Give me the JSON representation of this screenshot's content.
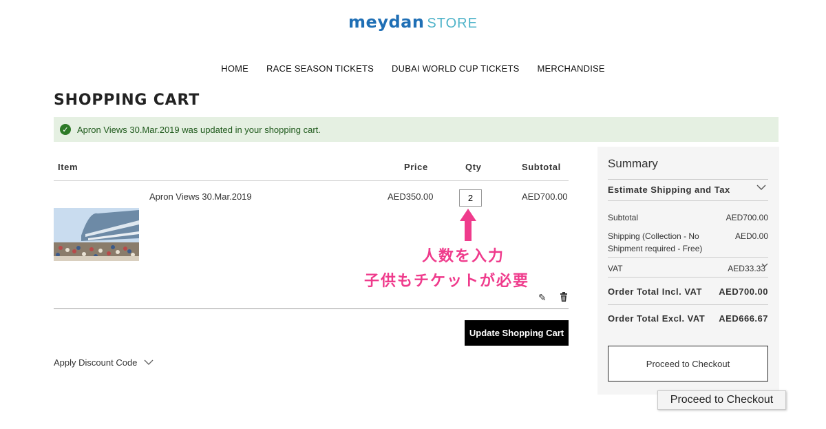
{
  "header": {
    "logo_brand": "meydan",
    "logo_store": "STORE"
  },
  "nav": {
    "items": [
      "HOME",
      "RACE SEASON TICKETS",
      "DUBAI WORLD CUP TICKETS",
      "MERCHANDISE"
    ]
  },
  "page_title": "SHOPPING CART",
  "message": {
    "text": "Apron Views 30.Mar.2019 was updated in your shopping cart.",
    "icon": "check-circle-icon",
    "color": "#2d7a27"
  },
  "cart": {
    "headers": {
      "item": "Item",
      "price": "Price",
      "qty": "Qty",
      "subtotal": "Subtotal"
    },
    "items": [
      {
        "name": "Apron Views 30.Mar.2019",
        "price": "AED350.00",
        "qty": "2",
        "subtotal": "AED700.00"
      }
    ],
    "update_button": "Update Shopping Cart",
    "discount_label": "Apply Discount Code"
  },
  "annotation": {
    "line1": "人数を入力",
    "line2": "子供もチケットが必要",
    "color": "#ef3b8c"
  },
  "summary": {
    "title": "Summary",
    "estimate_label": "Estimate Shipping and Tax",
    "subtotal_label": "Subtotal",
    "subtotal_value": "AED700.00",
    "shipping_label": "Shipping (Collection - No Shipment required - Free)",
    "shipping_value": "AED0.00",
    "vat_label": "VAT",
    "vat_value": "AED33.33",
    "total_incl_label": "Order Total Incl. VAT",
    "total_incl_value": "AED700.00",
    "total_excl_label": "Order Total Excl. VAT",
    "total_excl_value": "AED666.67",
    "checkout_button": "Proceed to Checkout"
  },
  "tooltip": "Proceed to Checkout"
}
